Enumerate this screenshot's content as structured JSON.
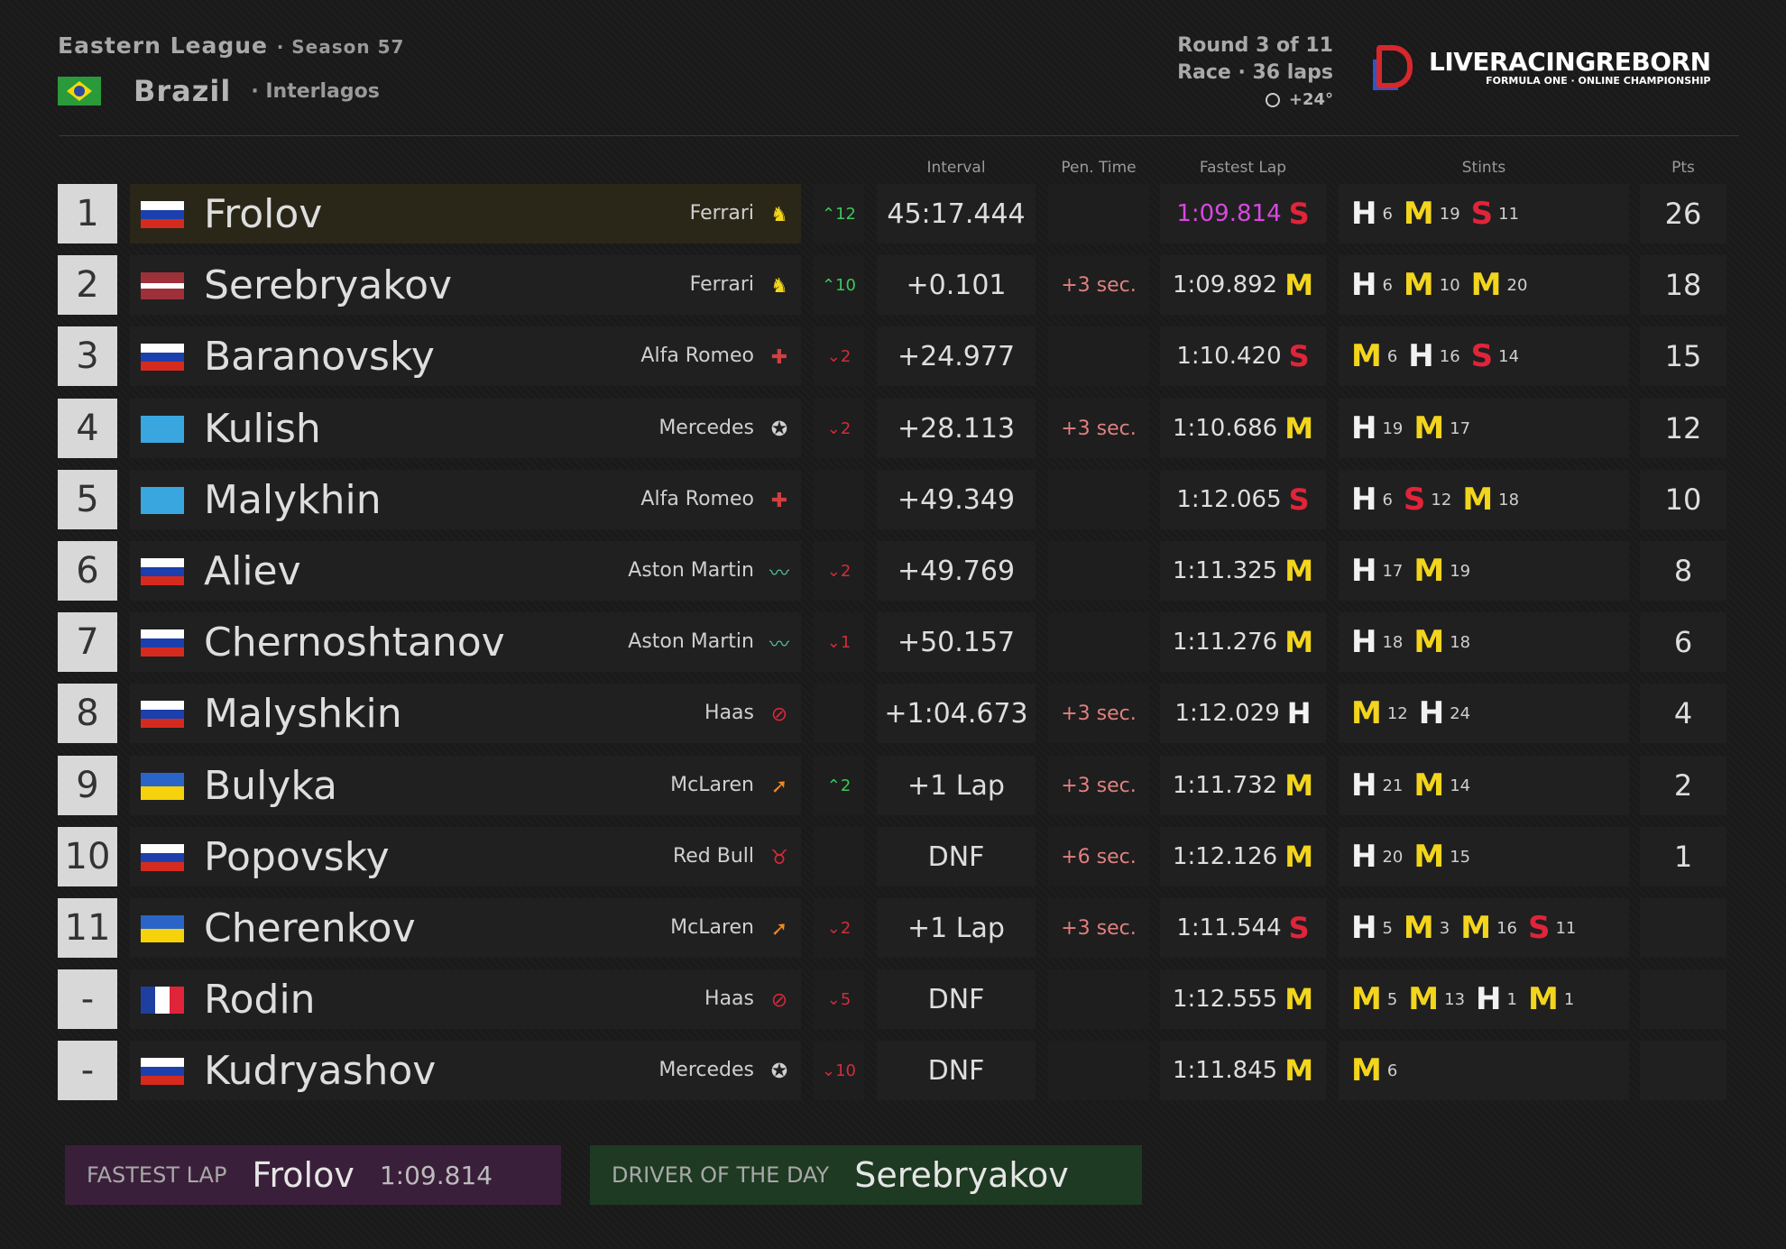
{
  "header": {
    "league": "Eastern League",
    "season": "· Season 57",
    "country": "Brazil",
    "track": "· Interlagos",
    "round": "Round 3 of 11",
    "race": "Race · 36 laps",
    "weather": "+24°"
  },
  "brand": {
    "name": "LIVERACINGREBORN",
    "subtitle": "FORMULA ONE · ONLINE CHAMPIONSHIP"
  },
  "columns": {
    "interval": "Interval",
    "pen_time": "Pen. Time",
    "fastest_lap": "Fastest Lap",
    "stints": "Stints",
    "pts": "Pts"
  },
  "colors": {
    "soft": "#e0243a",
    "medium": "#f2d51c",
    "hard": "#f2f2f2",
    "fastest_purple": "#d648e0",
    "gain": "#3cc85a",
    "loss": "#d32c3a"
  },
  "results": [
    {
      "pos": "1",
      "flag": "ru",
      "driver": "Frolov",
      "team": "Ferrari",
      "logo": "ferrari-icon",
      "change": "12",
      "dir": "up",
      "interval": "45:17.444",
      "penalty": "",
      "fastest": "1:09.814",
      "fl_tyre": "S",
      "best": true,
      "stints": [
        [
          "H",
          "6"
        ],
        [
          "M",
          "19"
        ],
        [
          "S",
          "11"
        ]
      ],
      "pts": "26"
    },
    {
      "pos": "2",
      "flag": "lv",
      "driver": "Serebryakov",
      "team": "Ferrari",
      "logo": "ferrari-icon",
      "change": "10",
      "dir": "up",
      "interval": "+0.101",
      "penalty": "+3 sec.",
      "fastest": "1:09.892",
      "fl_tyre": "M",
      "best": false,
      "stints": [
        [
          "H",
          "6"
        ],
        [
          "M",
          "10"
        ],
        [
          "M",
          "20"
        ]
      ],
      "pts": "18"
    },
    {
      "pos": "3",
      "flag": "ru",
      "driver": "Baranovsky",
      "team": "Alfa Romeo",
      "logo": "alfa-romeo-icon",
      "change": "2",
      "dir": "down",
      "interval": "+24.977",
      "penalty": "",
      "fastest": "1:10.420",
      "fl_tyre": "S",
      "best": false,
      "stints": [
        [
          "M",
          "6"
        ],
        [
          "H",
          "16"
        ],
        [
          "S",
          "14"
        ]
      ],
      "pts": "15"
    },
    {
      "pos": "4",
      "flag": "kz",
      "driver": "Kulish",
      "team": "Mercedes",
      "logo": "mercedes-icon",
      "change": "2",
      "dir": "down",
      "interval": "+28.113",
      "penalty": "+3 sec.",
      "fastest": "1:10.686",
      "fl_tyre": "M",
      "best": false,
      "stints": [
        [
          "H",
          "19"
        ],
        [
          "M",
          "17"
        ]
      ],
      "pts": "12"
    },
    {
      "pos": "5",
      "flag": "kz",
      "driver": "Malykhin",
      "team": "Alfa Romeo",
      "logo": "alfa-romeo-icon",
      "change": "",
      "dir": "",
      "interval": "+49.349",
      "penalty": "",
      "fastest": "1:12.065",
      "fl_tyre": "S",
      "best": false,
      "stints": [
        [
          "H",
          "6"
        ],
        [
          "S",
          "12"
        ],
        [
          "M",
          "18"
        ]
      ],
      "pts": "10"
    },
    {
      "pos": "6",
      "flag": "ru",
      "driver": "Aliev",
      "team": "Aston Martin",
      "logo": "aston-martin-icon",
      "change": "2",
      "dir": "down",
      "interval": "+49.769",
      "penalty": "",
      "fastest": "1:11.325",
      "fl_tyre": "M",
      "best": false,
      "stints": [
        [
          "H",
          "17"
        ],
        [
          "M",
          "19"
        ]
      ],
      "pts": "8"
    },
    {
      "pos": "7",
      "flag": "ru",
      "driver": "Chernoshtanov",
      "team": "Aston Martin",
      "logo": "aston-martin-icon",
      "change": "1",
      "dir": "down",
      "interval": "+50.157",
      "penalty": "",
      "fastest": "1:11.276",
      "fl_tyre": "M",
      "best": false,
      "stints": [
        [
          "H",
          "18"
        ],
        [
          "M",
          "18"
        ]
      ],
      "pts": "6"
    },
    {
      "pos": "8",
      "flag": "ru",
      "driver": "Malyshkin",
      "team": "Haas",
      "logo": "haas-icon",
      "change": "",
      "dir": "",
      "interval": "+1:04.673",
      "penalty": "+3 sec.",
      "fastest": "1:12.029",
      "fl_tyre": "H",
      "best": false,
      "stints": [
        [
          "M",
          "12"
        ],
        [
          "H",
          "24"
        ]
      ],
      "pts": "4"
    },
    {
      "pos": "9",
      "flag": "ua",
      "driver": "Bulyka",
      "team": "McLaren",
      "logo": "mclaren-icon",
      "change": "2",
      "dir": "up",
      "interval": "+1 Lap",
      "penalty": "+3 sec.",
      "fastest": "1:11.732",
      "fl_tyre": "M",
      "best": false,
      "stints": [
        [
          "H",
          "21"
        ],
        [
          "M",
          "14"
        ]
      ],
      "pts": "2"
    },
    {
      "pos": "10",
      "flag": "ru",
      "driver": "Popovsky",
      "team": "Red Bull",
      "logo": "red-bull-icon",
      "change": "",
      "dir": "",
      "interval": "DNF",
      "penalty": "+6 sec.",
      "fastest": "1:12.126",
      "fl_tyre": "M",
      "best": false,
      "stints": [
        [
          "H",
          "20"
        ],
        [
          "M",
          "15"
        ]
      ],
      "pts": "1"
    },
    {
      "pos": "11",
      "flag": "ua",
      "driver": "Cherenkov",
      "team": "McLaren",
      "logo": "mclaren-icon",
      "change": "2",
      "dir": "down",
      "interval": "+1 Lap",
      "penalty": "+3 sec.",
      "fastest": "1:11.544",
      "fl_tyre": "S",
      "best": false,
      "stints": [
        [
          "H",
          "5"
        ],
        [
          "M",
          "3"
        ],
        [
          "M",
          "16"
        ],
        [
          "S",
          "11"
        ]
      ],
      "pts": ""
    },
    {
      "pos": "-",
      "flag": "fr",
      "driver": "Rodin",
      "team": "Haas",
      "logo": "haas-icon",
      "change": "5",
      "dir": "down",
      "interval": "DNF",
      "penalty": "",
      "fastest": "1:12.555",
      "fl_tyre": "M",
      "best": false,
      "stints": [
        [
          "M",
          "5"
        ],
        [
          "M",
          "13"
        ],
        [
          "H",
          "1"
        ],
        [
          "M",
          "1"
        ]
      ],
      "pts": ""
    },
    {
      "pos": "-",
      "flag": "ru",
      "driver": "Kudryashov",
      "team": "Mercedes",
      "logo": "mercedes-icon",
      "change": "10",
      "dir": "down",
      "interval": "DNF",
      "penalty": "",
      "fastest": "1:11.845",
      "fl_tyre": "M",
      "best": false,
      "stints": [
        [
          "M",
          "6"
        ]
      ],
      "pts": ""
    }
  ],
  "awards": {
    "fastest_label": "FASTEST LAP",
    "fastest_driver": "Frolov",
    "fastest_time": "1:09.814",
    "dotd_label": "DRIVER OF THE DAY",
    "dotd_driver": "Serebryakov"
  }
}
